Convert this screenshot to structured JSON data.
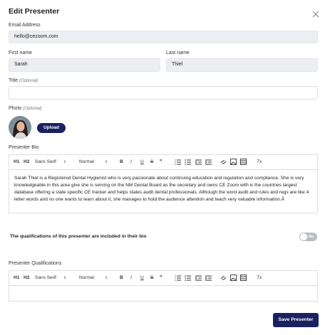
{
  "modal": {
    "title": "Edit Presenter"
  },
  "fields": {
    "email": {
      "label": "Email Address",
      "value": "hello@cezoom.com"
    },
    "first_name": {
      "label": "First name",
      "value": "Sarah"
    },
    "last_name": {
      "label": "Last name",
      "value": "Thiel"
    },
    "title": {
      "label": "Title",
      "optional": "(Optional)",
      "value": ""
    },
    "photo": {
      "label": "Photo",
      "optional": "(Optional)",
      "upload_label": "Upload"
    }
  },
  "bio": {
    "label": "Presenter Bio",
    "text": "Sarah Thiel is a Registered Dental Hygienist who is very passionate about continuing education and regulation and compliance. She is very knowledgeable in this area give she is serving on the NM Dental Board as the secretary and owns CE Zoom with is the countries largest database offering a state specific CE tracker and helps states audit dental professionals. Although the word audit and rules and regs are like 4 letter words and no one wants to learn about it, she manages to hold the audience attention and teach very valuable information.Â"
  },
  "toolbar": {
    "h1": "H1",
    "h2": "H2",
    "font": "Sans Serif",
    "size": "Normal",
    "bold": "B",
    "italic": "I",
    "underline": "U",
    "strike": "S",
    "quote": "❞",
    "clear": "Tx"
  },
  "qualifications_toggle": {
    "label": "The qualifications of this presenter are included in their bio",
    "state": "No"
  },
  "qualifications": {
    "label": "Presenter Qualifications",
    "text": ""
  },
  "actions": {
    "save_label": "Save Presenter"
  }
}
